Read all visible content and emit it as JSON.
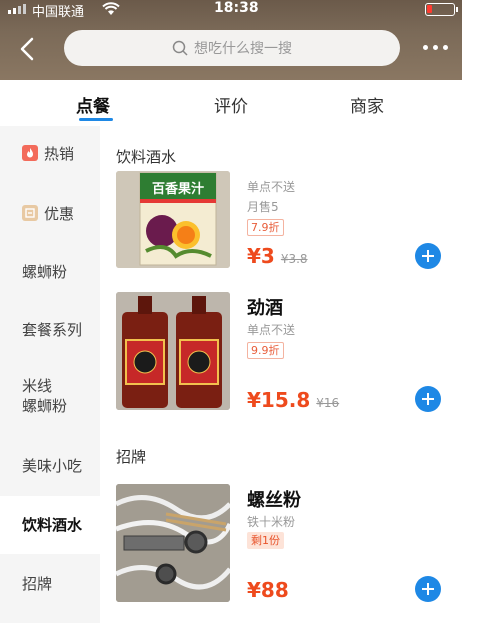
{
  "status": {
    "carrier": "中国联通",
    "time": "18:38"
  },
  "header": {
    "search_placeholder": "想吃什么搜一搜",
    "back_icon": "chevron-left-icon",
    "more_icon": "more-icon"
  },
  "tabs": [
    {
      "label": "点餐",
      "active": true
    },
    {
      "label": "评价",
      "active": false
    },
    {
      "label": "商家",
      "active": false
    }
  ],
  "sidebar": {
    "items": [
      {
        "label": "热销",
        "icon": "fire-icon",
        "icon_color": "#f36b5b"
      },
      {
        "label": "优惠",
        "icon": "coupon-icon",
        "icon_color": "#e8c9a3"
      },
      {
        "label": "螺蛳粉"
      },
      {
        "label": "套餐系列"
      },
      {
        "label": "米线",
        "label2": "螺蛳粉"
      },
      {
        "label": "美味小吃"
      },
      {
        "label": "饮料酒水",
        "active": true
      },
      {
        "label": "招牌"
      }
    ]
  },
  "sections": [
    {
      "title": "饮料酒水",
      "products": [
        {
          "name": "",
          "image_text": "百香果汁",
          "sub1": "单点不送",
          "sub2": "月售5",
          "tag": "7.9折",
          "price": "¥3",
          "old_price": "¥3.8"
        },
        {
          "name": "劲酒",
          "sub1": "单点不送",
          "tag": "9.9折",
          "price": "¥15.8",
          "old_price": "¥16"
        }
      ]
    },
    {
      "title": "招牌",
      "products": [
        {
          "name": "螺丝粉",
          "sub1": "铁十米粉",
          "tag": "剩1份",
          "price": "¥88"
        }
      ]
    }
  ],
  "colors": {
    "accent": "#1e88e5",
    "price": "#ee4a1d"
  }
}
